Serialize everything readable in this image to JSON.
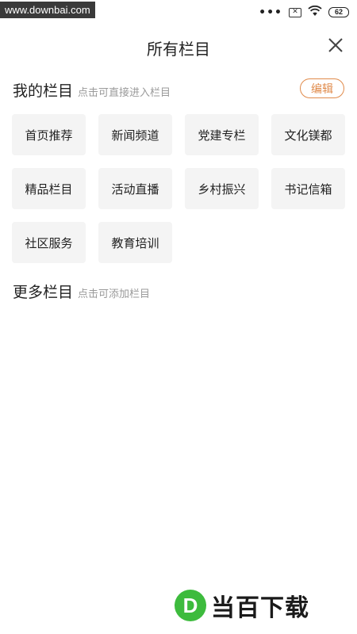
{
  "status_bar": {
    "watermark_url": "www.downbai.com",
    "dots": "•••",
    "sim_icon": "sim-x-icon",
    "wifi_icon": "wifi-icon",
    "battery": "62"
  },
  "header": {
    "title": "所有栏目",
    "close_icon": "close-icon"
  },
  "my_channels": {
    "title": "我的栏目",
    "hint": "点击可直接进入栏目",
    "edit_label": "编辑",
    "items": [
      {
        "label": "首页推荐"
      },
      {
        "label": "新闻频道"
      },
      {
        "label": "党建专栏"
      },
      {
        "label": "文化镁都"
      },
      {
        "label": "精品栏目"
      },
      {
        "label": "活动直播"
      },
      {
        "label": "乡村振兴"
      },
      {
        "label": "书记信箱"
      },
      {
        "label": "社区服务"
      },
      {
        "label": "教育培训"
      }
    ]
  },
  "more_channels": {
    "title": "更多栏目",
    "hint": "点击可添加栏目"
  },
  "watermark_logo": {
    "letter": "D",
    "text": "当百下载"
  },
  "colors": {
    "accent": "#e08a4a",
    "tile_bg": "#f4f4f4",
    "hint_text": "#9a9a9a",
    "logo_green": "#3dbb3d"
  }
}
